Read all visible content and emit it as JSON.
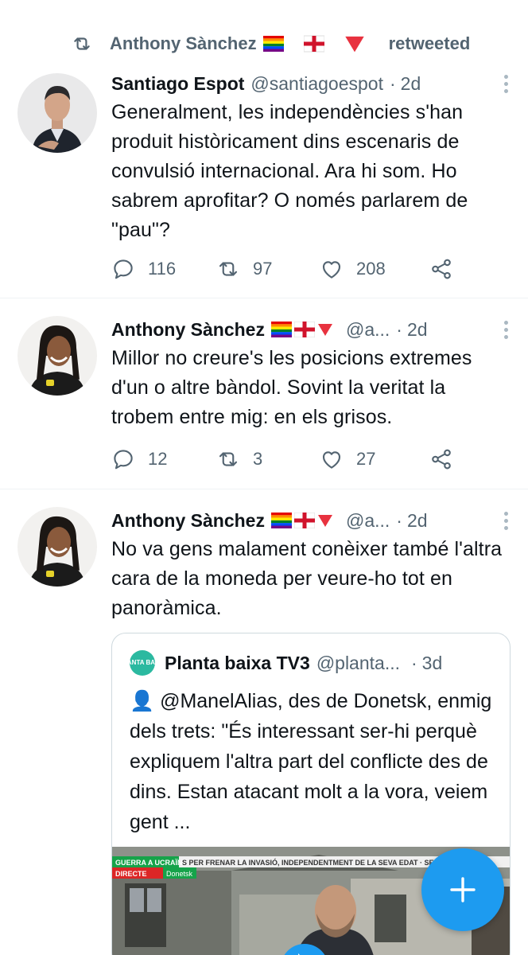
{
  "retweet_banner": {
    "text_name": "Anthony Sànchez",
    "text_action": "retweeted",
    "icon": "retweet-icon"
  },
  "tweets": [
    {
      "author": "Santiago Espot",
      "handle": "@santiagoespot",
      "separator": "·",
      "time": "2d",
      "text": "Generalment, les independències s'han produit històricament dins escenaris de convulsió internacional. Ara hi som. Ho sabrem aprofitar? O només parlarem de \"pau\"?",
      "replies": "116",
      "retweets": "97",
      "likes": "208"
    },
    {
      "author": "Anthony Sànchez",
      "handle": "@a...",
      "separator": "·",
      "time": "2d",
      "text": "Millor no creure's les posicions extremes d'un o altre bàndol. Sovint la veritat la trobem entre mig: en els grisos.",
      "replies": "12",
      "retweets": "3",
      "likes": "27"
    },
    {
      "author": "Anthony Sànchez",
      "handle": "@a...",
      "separator": "·",
      "time": "2d",
      "text": "No va gens malament conèixer també l'altra cara de la moneda per veure-ho tot en panoràmica."
    }
  ],
  "quoted_tweet": {
    "author": "Planta baixa TV3",
    "handle": "@planta...",
    "separator": "·",
    "time": "3d",
    "avatar_text": "PLANTA BAIXA",
    "text": "👤 @ManelAlias, des de Donetsk, enmig dels trets: \"És interessant ser-hi perquè expliquem l'altra part del conflicte des de dins. Estan atacant molt a la vora, veiem gent ...",
    "media": {
      "banner_tag": "GUERRA A UCRAÏNA",
      "ticker": "S PER FRENAR LA INVASIÓ, INDEPENDENTMENT DE LA SEVA EDAT · SEGONS",
      "live_tag": "DIRECTE",
      "location_tag": "Donetsk"
    }
  },
  "colors": {
    "accent": "#1d9bf0",
    "text_primary": "#0f1419",
    "text_secondary": "#536471",
    "divider": "#eff3f4"
  },
  "fab": {
    "icon": "plus-icon",
    "label": "+"
  }
}
